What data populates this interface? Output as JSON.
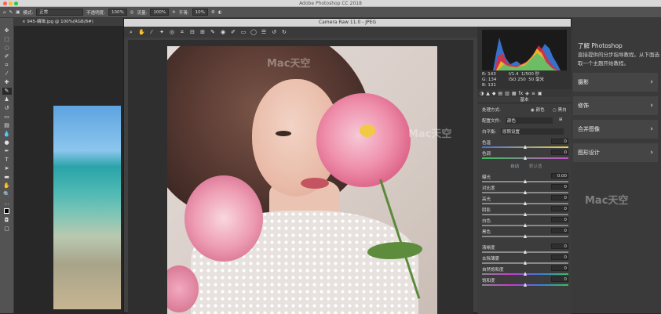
{
  "app": {
    "window_title": "Adobe Photoshop CC 2018",
    "doc_tab": "945-编辑.jpg @ 100%(RGB/8#)"
  },
  "options_bar": {
    "mode_label": "模式:",
    "mode_value": "正常",
    "opacity_label": "不透明度:",
    "opacity_value": "100%",
    "flow_label": "流量:",
    "flow_value": "100%",
    "smooth_label": "平滑:",
    "smooth_value": "10%"
  },
  "camera_raw": {
    "title": "Camera Raw 11.0 - JPEG",
    "readout": {
      "r": "R: 143",
      "g": "G: 134",
      "b": "B: 131",
      "aperture": "f/1.4",
      "shutter": "1/500 秒",
      "iso": "ISO 250",
      "focal": "50 毫米"
    },
    "basic": {
      "header": "基本",
      "treatment_label": "处理方式:",
      "treatment_color": "颜色",
      "treatment_bw": "黑白",
      "profile_label": "配置文件:",
      "profile_value": "颜色",
      "wb_label": "白平衡:",
      "wb_value": "原照设置",
      "auto": "自动",
      "default": "默认值",
      "sliders": [
        {
          "label": "色温",
          "value": "0",
          "pos": 0.5
        },
        {
          "label": "色调",
          "value": "0",
          "pos": 0.5
        },
        {
          "label": "曝光",
          "value": "0.00",
          "pos": 0.5
        },
        {
          "label": "对比度",
          "value": "0",
          "pos": 0.5
        },
        {
          "label": "高光",
          "value": "0",
          "pos": 0.5
        },
        {
          "label": "阴影",
          "value": "0",
          "pos": 0.5
        },
        {
          "label": "白色",
          "value": "0",
          "pos": 0.5
        },
        {
          "label": "黑色",
          "value": "0",
          "pos": 0.5
        },
        {
          "label": "清晰度",
          "value": "0",
          "pos": 0.5
        },
        {
          "label": "去除薄雾",
          "value": "0",
          "pos": 0.5
        },
        {
          "label": "自然饱和度",
          "value": "0",
          "pos": 0.5
        },
        {
          "label": "饱和度",
          "value": "0",
          "pos": 0.5
        }
      ]
    }
  },
  "learn_panel": {
    "title": "了解 Photoshop",
    "subtitle": "直接提供的分步指导教程。从下面选取一个主题开始教程。",
    "items": [
      "摄影",
      "修饰",
      "合并图像",
      "图形设计"
    ]
  },
  "watermark": "Mac天空"
}
